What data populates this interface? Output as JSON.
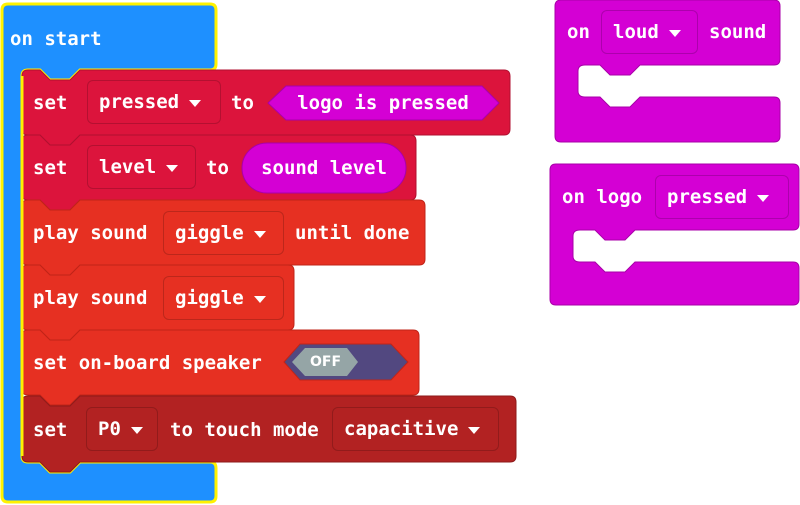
{
  "workspace": {
    "colors": {
      "basic": "#1E90FF",
      "selected_outline": "#FFF200",
      "variables": "#DC143C",
      "input": "#D400D4",
      "music": "#E63022",
      "pins": "#B22222",
      "toggle_track": "#524880",
      "toggle_knob": "#95A5A6"
    },
    "on_start": {
      "label": "on start",
      "statements": [
        {
          "kind": "set-variable",
          "set_label": "set",
          "variable": "pressed",
          "to_label": "to",
          "value": {
            "type": "boolean-reporter",
            "text": "logo is pressed"
          }
        },
        {
          "kind": "set-variable",
          "set_label": "set",
          "variable": "level",
          "to_label": "to",
          "value": {
            "type": "number-reporter",
            "text": "sound level"
          }
        },
        {
          "kind": "play-sound-until-done",
          "play_label": "play sound",
          "sound": "giggle",
          "suffix": "until done"
        },
        {
          "kind": "play-sound",
          "play_label": "play sound",
          "sound": "giggle"
        },
        {
          "kind": "set-speaker",
          "label": "set on-board speaker",
          "toggle": "OFF"
        },
        {
          "kind": "set-touch-mode",
          "set_label": "set",
          "pin": "P0",
          "mid_label": "to touch mode",
          "mode": "capacitive"
        }
      ]
    },
    "on_loud_sound": {
      "on_label": "on",
      "level": "loud",
      "suffix": "sound"
    },
    "on_logo_pressed": {
      "label": "on logo",
      "event": "pressed"
    }
  }
}
